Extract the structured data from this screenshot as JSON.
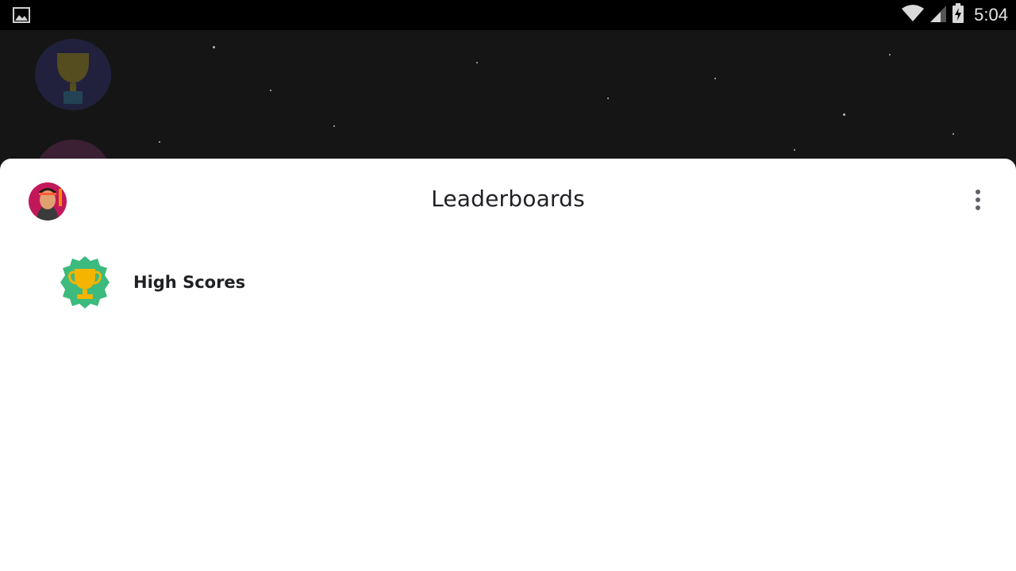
{
  "status_bar": {
    "time": "5:04",
    "icons": [
      "image-notification-icon",
      "wifi-icon",
      "cell-signal-icon",
      "battery-charging-icon"
    ]
  },
  "background": {
    "badges": [
      "trophy-badge-icon",
      "achievement-badge-icon"
    ]
  },
  "sheet": {
    "title": "Leaderboards",
    "avatar": "player-avatar",
    "menu_icon": "more-vert-icon",
    "leaderboards": [
      {
        "label": "High Scores",
        "icon": "trophy-icon"
      }
    ]
  },
  "colors": {
    "badge_green": "#3dba7e",
    "trophy_gold": "#f5b400",
    "avatar_bg": "#c2185b",
    "text_primary": "#202124",
    "sheet_bg": "#ffffff",
    "game_bg": "#151515"
  }
}
